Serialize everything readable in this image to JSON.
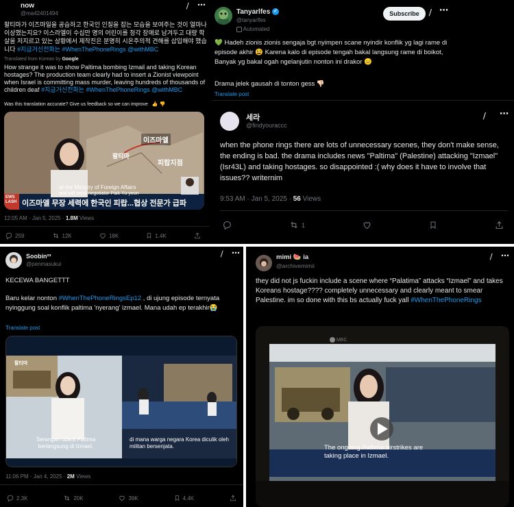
{
  "p1": {
    "name": "now",
    "handle": "@ma42401494",
    "korean_text": "팔티마가 이즈마일을 공습하고 한국인 인질을 잡는 모습을 보여주는 것이 얼마나 이상했는지요? 이스라엘이 수십만 명의 어린이를 청각 장애로 남겨두고 대량 학살을 저지르고 있는 상황에서 제작진은 분명히 시온주의적 견해를 삽입해야 했습니다",
    "korean_hashtags": "#지금거신전화는 #WhenThePhoneRings @withMBC",
    "translated_from": "Translated from Korean by",
    "translator": "Google",
    "translation": "How strange it was to show Paltima bombing Izmail and taking Korean hostages? The production team clearly had to insert a Zionist viewpoint when Israel is committing mass murder, leaving hundreds of thousands of children deaf",
    "translation_tags": "#지금거신전화는 #WhenThePhoneRings @withMBC",
    "feedback": "Was this translation accurate? Give us feedback so we can improve",
    "map_label_1": "이즈마엘",
    "map_label_2": "팔티마",
    "map_label_3": "피랍지점",
    "sub_1": "at the Ministry of Foreign Affairs",
    "sub_2": "and will send negotiator Paik Yu-yeon",
    "ticker_left": "EWS\nLASH",
    "ticker": "이즈마엘 무장 세력에 한국인 피랍...협상 전문가 급파",
    "time": "12:05 AM · Jan 5, 2025 ·",
    "views_count": "1.8M",
    "views_label": "Views",
    "replies": "259",
    "reposts": "12K",
    "likes": "18K",
    "bookmarks": "1.4K"
  },
  "p2": {
    "name": "Tanyarlfes",
    "handle": "@tanyarlfes",
    "automated": "Automated",
    "subscribe": "Subscribe",
    "text": "💚 Hadeh zionis zionis sengaja bgt nyimpen scane nyindir konflik yg lagi rame di episode akhir 😫 Karena kalo di episode tengah bakal langsung rame di boikot, Banyak yg bakal ogah ngelanjutin nonton ini drakor 😑",
    "text2": "Drama jelek gausah di tonton gess 👎🏻",
    "translate": "Translate post",
    "quote": {
      "name": "세라",
      "handle": "@findyouraccc",
      "text": "when the phone rings there are lots of unnecessary scenes, they don't make sense, the ending is bad. the drama includes news \"Paltima\" (Palestine) attacking \"Izmael\" (Isr43L) and taking hostages. so disappointed :( why does it have to involve that issues?? writernim",
      "time": "9:53 AM · Jan 5, 2025 ·",
      "views_count": "56",
      "views_label": "Views",
      "reposts": "1"
    }
  },
  "p3": {
    "name": "Soobin²³",
    "handle": "@penmasukui",
    "line1": "KECEWA BANGETTT",
    "line2a": "Baru kelar nonton ",
    "line2tag": "#WhenThePhoneRingsEp12",
    "line2b": " , di ujung episode ternyata nyinggung soal konflik paltima 'nyerang' izmael. Mana udah ep terakhir😭",
    "translate": "Translate post",
    "img_label": "팔티마",
    "sub_left": "Serangan udara Paltima berlangsung di Izmael.",
    "sub_right": "di mana warga negara Korea diculik oleh militan bersenjata.",
    "time": "11:06 PM · Jan 4, 2025 ·",
    "views_count": "2M",
    "views_label": "Views",
    "replies": "2.3K",
    "reposts": "20K",
    "likes": "39K",
    "bookmarks": "4.4K"
  },
  "p4": {
    "name": "mimi 🍉 ia",
    "handle": "@archivemimii",
    "text": "they did not js fuckin include a scene where “Palatima” attacks “Izmael” and takes Koreans hostage???? completely unnecessary and clearly meant to smear Palestine. im so done with this bs actually fuck yall",
    "tag": "#WhenThePhoneRings",
    "sub": "The ongoing Paltima airstrikes are taking place in Izmael.",
    "mbc": "MBC"
  },
  "colors": {
    "link": "#1d9bf0",
    "muted": "#71767b",
    "verified": "#1d9bf0"
  }
}
